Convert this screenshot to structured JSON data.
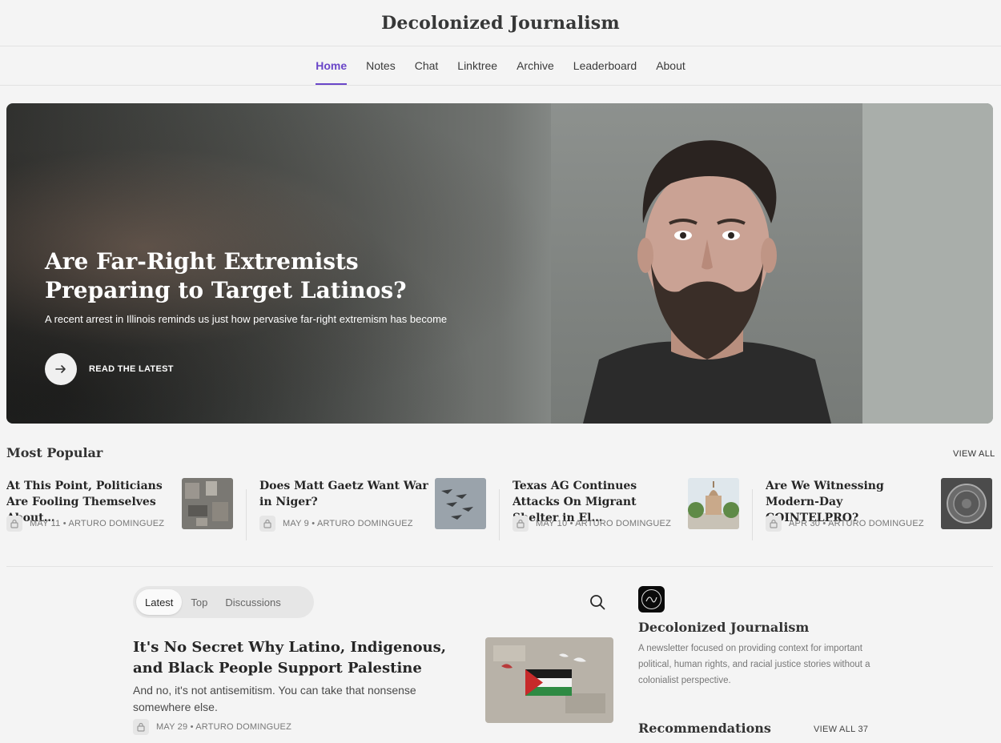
{
  "site": {
    "title": "Decolonized Journalism"
  },
  "nav": {
    "items": [
      {
        "label": "Home",
        "active": true
      },
      {
        "label": "Notes"
      },
      {
        "label": "Chat"
      },
      {
        "label": "Linktree"
      },
      {
        "label": "Archive"
      },
      {
        "label": "Leaderboard"
      },
      {
        "label": "About"
      }
    ],
    "accent_color": "#6a46c8"
  },
  "hero": {
    "title": "Are Far-Right Extremists Preparing to Target Latinos?",
    "subtitle": "A recent arrest in Illinois reminds us just how pervasive far-right extremism has become",
    "cta_label": "READ THE LATEST",
    "cta_icon": "arrow-right-icon"
  },
  "most_popular": {
    "title": "Most Popular",
    "view_all": "VIEW ALL",
    "items": [
      {
        "title": "At This Point, Politicians Are Fooling Themselves About…",
        "meta": "MAY 11 • ARTURO DOMINGUEZ"
      },
      {
        "title": "Does Matt Gaetz Want War in Niger?",
        "meta": "MAY 9 • ARTURO DOMINGUEZ"
      },
      {
        "title": "Texas AG Continues Attacks On Migrant Shelter in El…",
        "meta": "MAY 10 • ARTURO DOMINGUEZ"
      },
      {
        "title": "Are We Witnessing Modern-Day COINTELPRO?",
        "meta": "APR 30 • ARTURO DOMINGUEZ"
      }
    ]
  },
  "feed": {
    "tabs": [
      {
        "label": "Latest",
        "active": true
      },
      {
        "label": "Top"
      },
      {
        "label": "Discussions"
      }
    ],
    "search_icon": "search-icon",
    "post": {
      "title": "It's No Secret Why Latino, Indigenous, and Black People Support Palestine",
      "subtitle": "And no, it's not antisemitism. You can take that nonsense somewhere else.",
      "meta": "MAY 29 • ARTURO DOMINGUEZ"
    }
  },
  "sidebar": {
    "name": "Decolonized Journalism",
    "description": "A newsletter focused on providing context for important political, human rights, and racial justice stories without a colonialist perspective.",
    "recommendations_title": "Recommendations",
    "recommendations_view_all": "VIEW ALL 37"
  }
}
